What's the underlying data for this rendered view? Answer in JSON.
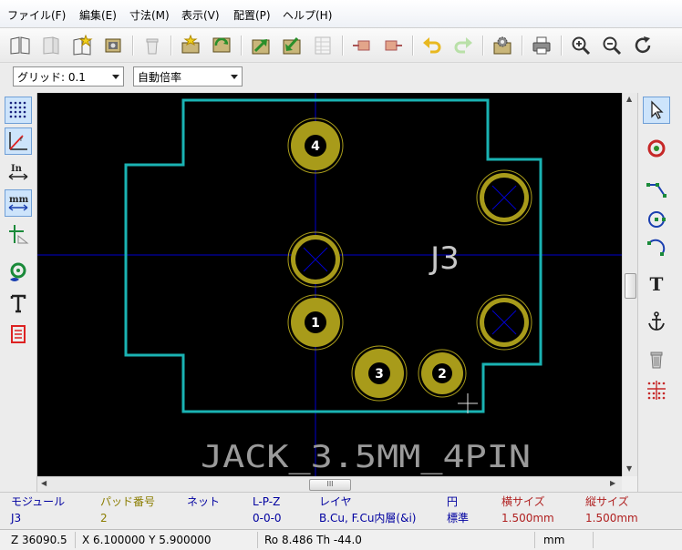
{
  "menu": [
    "ファイル(F)",
    "編集(E)",
    "寸法(M)",
    "表示(V)",
    "配置(P)",
    "ヘルプ(H)"
  ],
  "toolbar_icons": [
    "book-open-icon",
    "book-disabled-icon",
    "new-module-icon",
    "module-wizard-icon",
    "delete-icon",
    "load-module-icon",
    "save-module-icon",
    "export-icon",
    "import-icon",
    "grid-table-icon",
    "pad-from-board-icon",
    "pad-to-board-icon",
    "undo-icon",
    "redo-icon",
    "settings-icon",
    "print-icon",
    "zoom-in-icon",
    "zoom-out-icon",
    "redraw-icon"
  ],
  "aux": {
    "grid_select": "グリッド: 0.1",
    "zoom_select": "自動倍率"
  },
  "left_tools": [
    "grid-toggle-icon",
    "polar-coords-icon",
    "inch-units-icon",
    "mm-units-icon",
    "cursor-shape-icon",
    "pad-sketch-icon",
    "text-sketch-icon",
    "contrast-mode-icon"
  ],
  "left_tool_text": {
    "inch": "In",
    "mm": "mm"
  },
  "right_tools": [
    "select-arrow-icon",
    "add-pad-icon",
    "add-line-icon",
    "add-circle-icon",
    "add-arc-icon",
    "add-text-icon",
    "anchor-icon",
    "delete-tool-icon",
    "grid-origin-icon"
  ],
  "right_tool_text": {
    "text": "T"
  },
  "board": {
    "reference": "J3",
    "value": "JACK_3.5MM_4PIN",
    "pads": [
      {
        "label": "4"
      },
      {
        "label": "1"
      },
      {
        "label": "3"
      },
      {
        "label": "2"
      },
      {
        "label": ""
      },
      {
        "label": ""
      },
      {
        "label": ""
      }
    ]
  },
  "scroll_glyph": "III",
  "colors": {
    "outline": "#1ab3b3",
    "pad": "#a89b1a",
    "axis": "#0000cc",
    "text_silk": "#c8c8c8",
    "pad_label_bg": "#000000"
  },
  "info": {
    "headers": [
      "モジュール",
      "パッド番号",
      "ネット",
      "L-P-Z",
      "レイヤ",
      "円",
      "横サイズ",
      "縦サイズ"
    ],
    "values": [
      "J3",
      "2",
      "",
      "0-0-0",
      "B.Cu, F.Cu内層(&i)",
      "標準",
      "1.500mm",
      "1.500mm"
    ],
    "header_colors": [
      "#0000a0",
      "#8b7d00",
      "#0000a0",
      "#0000a0",
      "#0000a0",
      "#0000a0",
      "#b02020",
      "#b02020"
    ],
    "value_colors": [
      "#0000a0",
      "#8b7d00",
      "#0000a0",
      "#0000a0",
      "#0000a0",
      "#0000a0",
      "#b02020",
      "#b02020"
    ]
  },
  "status": {
    "zoom": "Z 36090.5",
    "xy": "X 6.100000  Y 5.900000",
    "polar": "Ro 8.486 Th -44.0",
    "units": "mm"
  }
}
